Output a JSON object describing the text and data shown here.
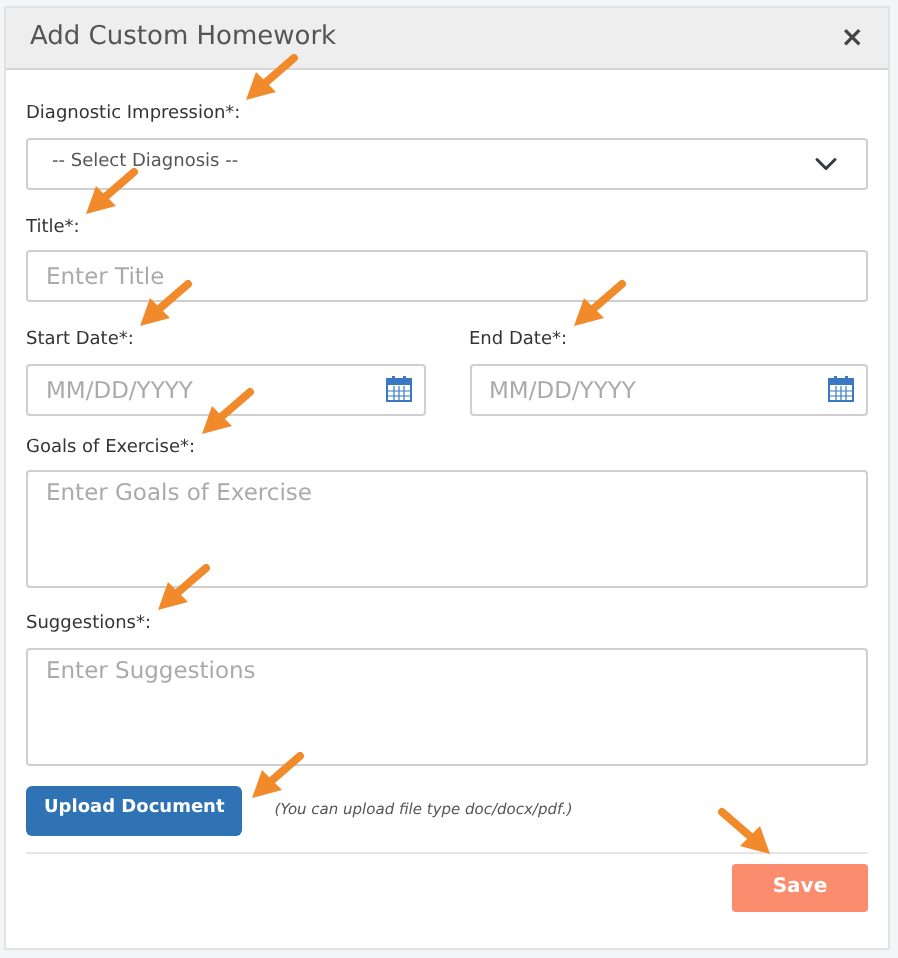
{
  "dialog": {
    "title": "Add Custom Homework",
    "close": "×"
  },
  "fields": [
    {
      "kind": "select",
      "label": "Diagnostic Impression*:",
      "value": "-- Select Diagnosis --"
    },
    {
      "kind": "text",
      "label": "Title*:",
      "placeholder": "Enter Title"
    },
    {
      "kind": "date",
      "label": "Start Date*:",
      "placeholder": "MM/DD/YYYY"
    },
    {
      "kind": "date",
      "label": "End Date*:",
      "placeholder": "MM/DD/YYYY"
    },
    {
      "kind": "textarea",
      "label": "Goals of Exercise*:",
      "placeholder": "Enter Goals of Exercise"
    },
    {
      "kind": "textarea",
      "label": "Suggestions*:",
      "placeholder": "Enter Suggestions"
    }
  ],
  "upload": {
    "button": "Upload Document",
    "hint": "(You can upload file type doc/docx/pdf.)"
  },
  "buttons": [
    "Save"
  ]
}
